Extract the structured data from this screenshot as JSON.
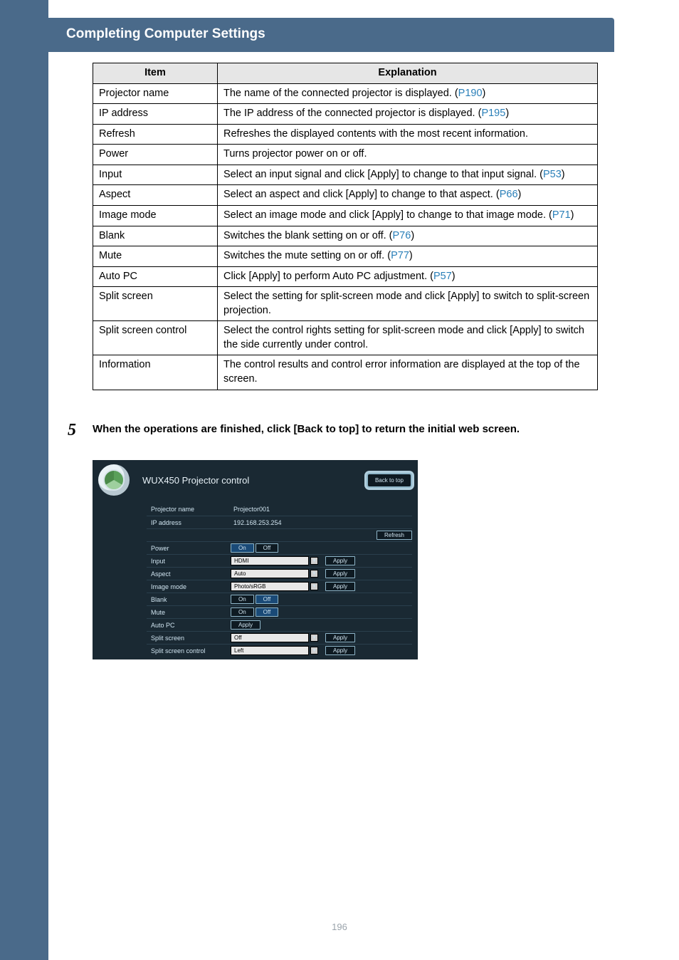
{
  "header": {
    "title": "Completing Computer Settings"
  },
  "table": {
    "head_item": "Item",
    "head_expl": "Explanation",
    "rows": [
      {
        "item": "Projector name",
        "expl_pre": "The name of the connected projector is displayed. (",
        "link": "P190",
        "expl_post": ")"
      },
      {
        "item": "IP address",
        "expl_pre": "The IP address of the connected projector is displayed. (",
        "link": "P195",
        "expl_post": ")"
      },
      {
        "item": "Refresh",
        "expl_pre": "Refreshes the displayed contents with the most recent information.",
        "link": "",
        "expl_post": ""
      },
      {
        "item": "Power",
        "expl_pre": "Turns projector power on or off.",
        "link": "",
        "expl_post": ""
      },
      {
        "item": "Input",
        "expl_pre": "Select an input signal and click [Apply] to change to that input signal. (",
        "link": "P53",
        "expl_post": ")"
      },
      {
        "item": "Aspect",
        "expl_pre": "Select an aspect and click [Apply] to change to that aspect. (",
        "link": "P66",
        "expl_post": ")"
      },
      {
        "item": "Image mode",
        "expl_pre": "Select an image mode and click [Apply] to change to that image mode. (",
        "link": "P71",
        "expl_post": ")"
      },
      {
        "item": "Blank",
        "expl_pre": "Switches the blank setting on or off. (",
        "link": "P76",
        "expl_post": ")"
      },
      {
        "item": "Mute",
        "expl_pre": "Switches the mute setting on or off. (",
        "link": "P77",
        "expl_post": ")"
      },
      {
        "item": "Auto PC",
        "expl_pre": "Click [Apply] to perform Auto PC adjustment. (",
        "link": "P57",
        "expl_post": ")"
      },
      {
        "item": "Split screen",
        "expl_pre": "Select the setting for split-screen mode and click [Apply] to switch to split-screen projection.",
        "link": "",
        "expl_post": ""
      },
      {
        "item": "Split screen control",
        "expl_pre": "Select the control rights setting for split-screen mode and click [Apply] to switch the side currently under control.",
        "link": "",
        "expl_post": ""
      },
      {
        "item": "Information",
        "expl_pre": "The control results and control error information are displayed at the top of the screen.",
        "link": "",
        "expl_post": ""
      }
    ]
  },
  "step5": {
    "num": "5",
    "text": "When the operations are finished, click [Back to top] to return the initial web screen."
  },
  "shot": {
    "title": "WUX450  Projector control",
    "back": "Back to top",
    "projname_l": "Projector name",
    "projname_v": "Projector001",
    "ip_l": "IP address",
    "ip_v": "192.168.253.254",
    "refresh": "Refresh",
    "power_l": "Power",
    "on": "On",
    "off": "Off",
    "input_l": "Input",
    "input_v": "HDMI",
    "aspect_l": "Aspect",
    "aspect_v": "Auto",
    "imgmode_l": "Image mode",
    "imgmode_v": "Photo/sRGB",
    "blank_l": "Blank",
    "mute_l": "Mute",
    "autopc_l": "Auto PC",
    "split_l": "Split screen",
    "split_v": "Off",
    "splitc_l": "Split screen control",
    "splitc_v": "Left",
    "apply": "Apply"
  },
  "page": "196"
}
